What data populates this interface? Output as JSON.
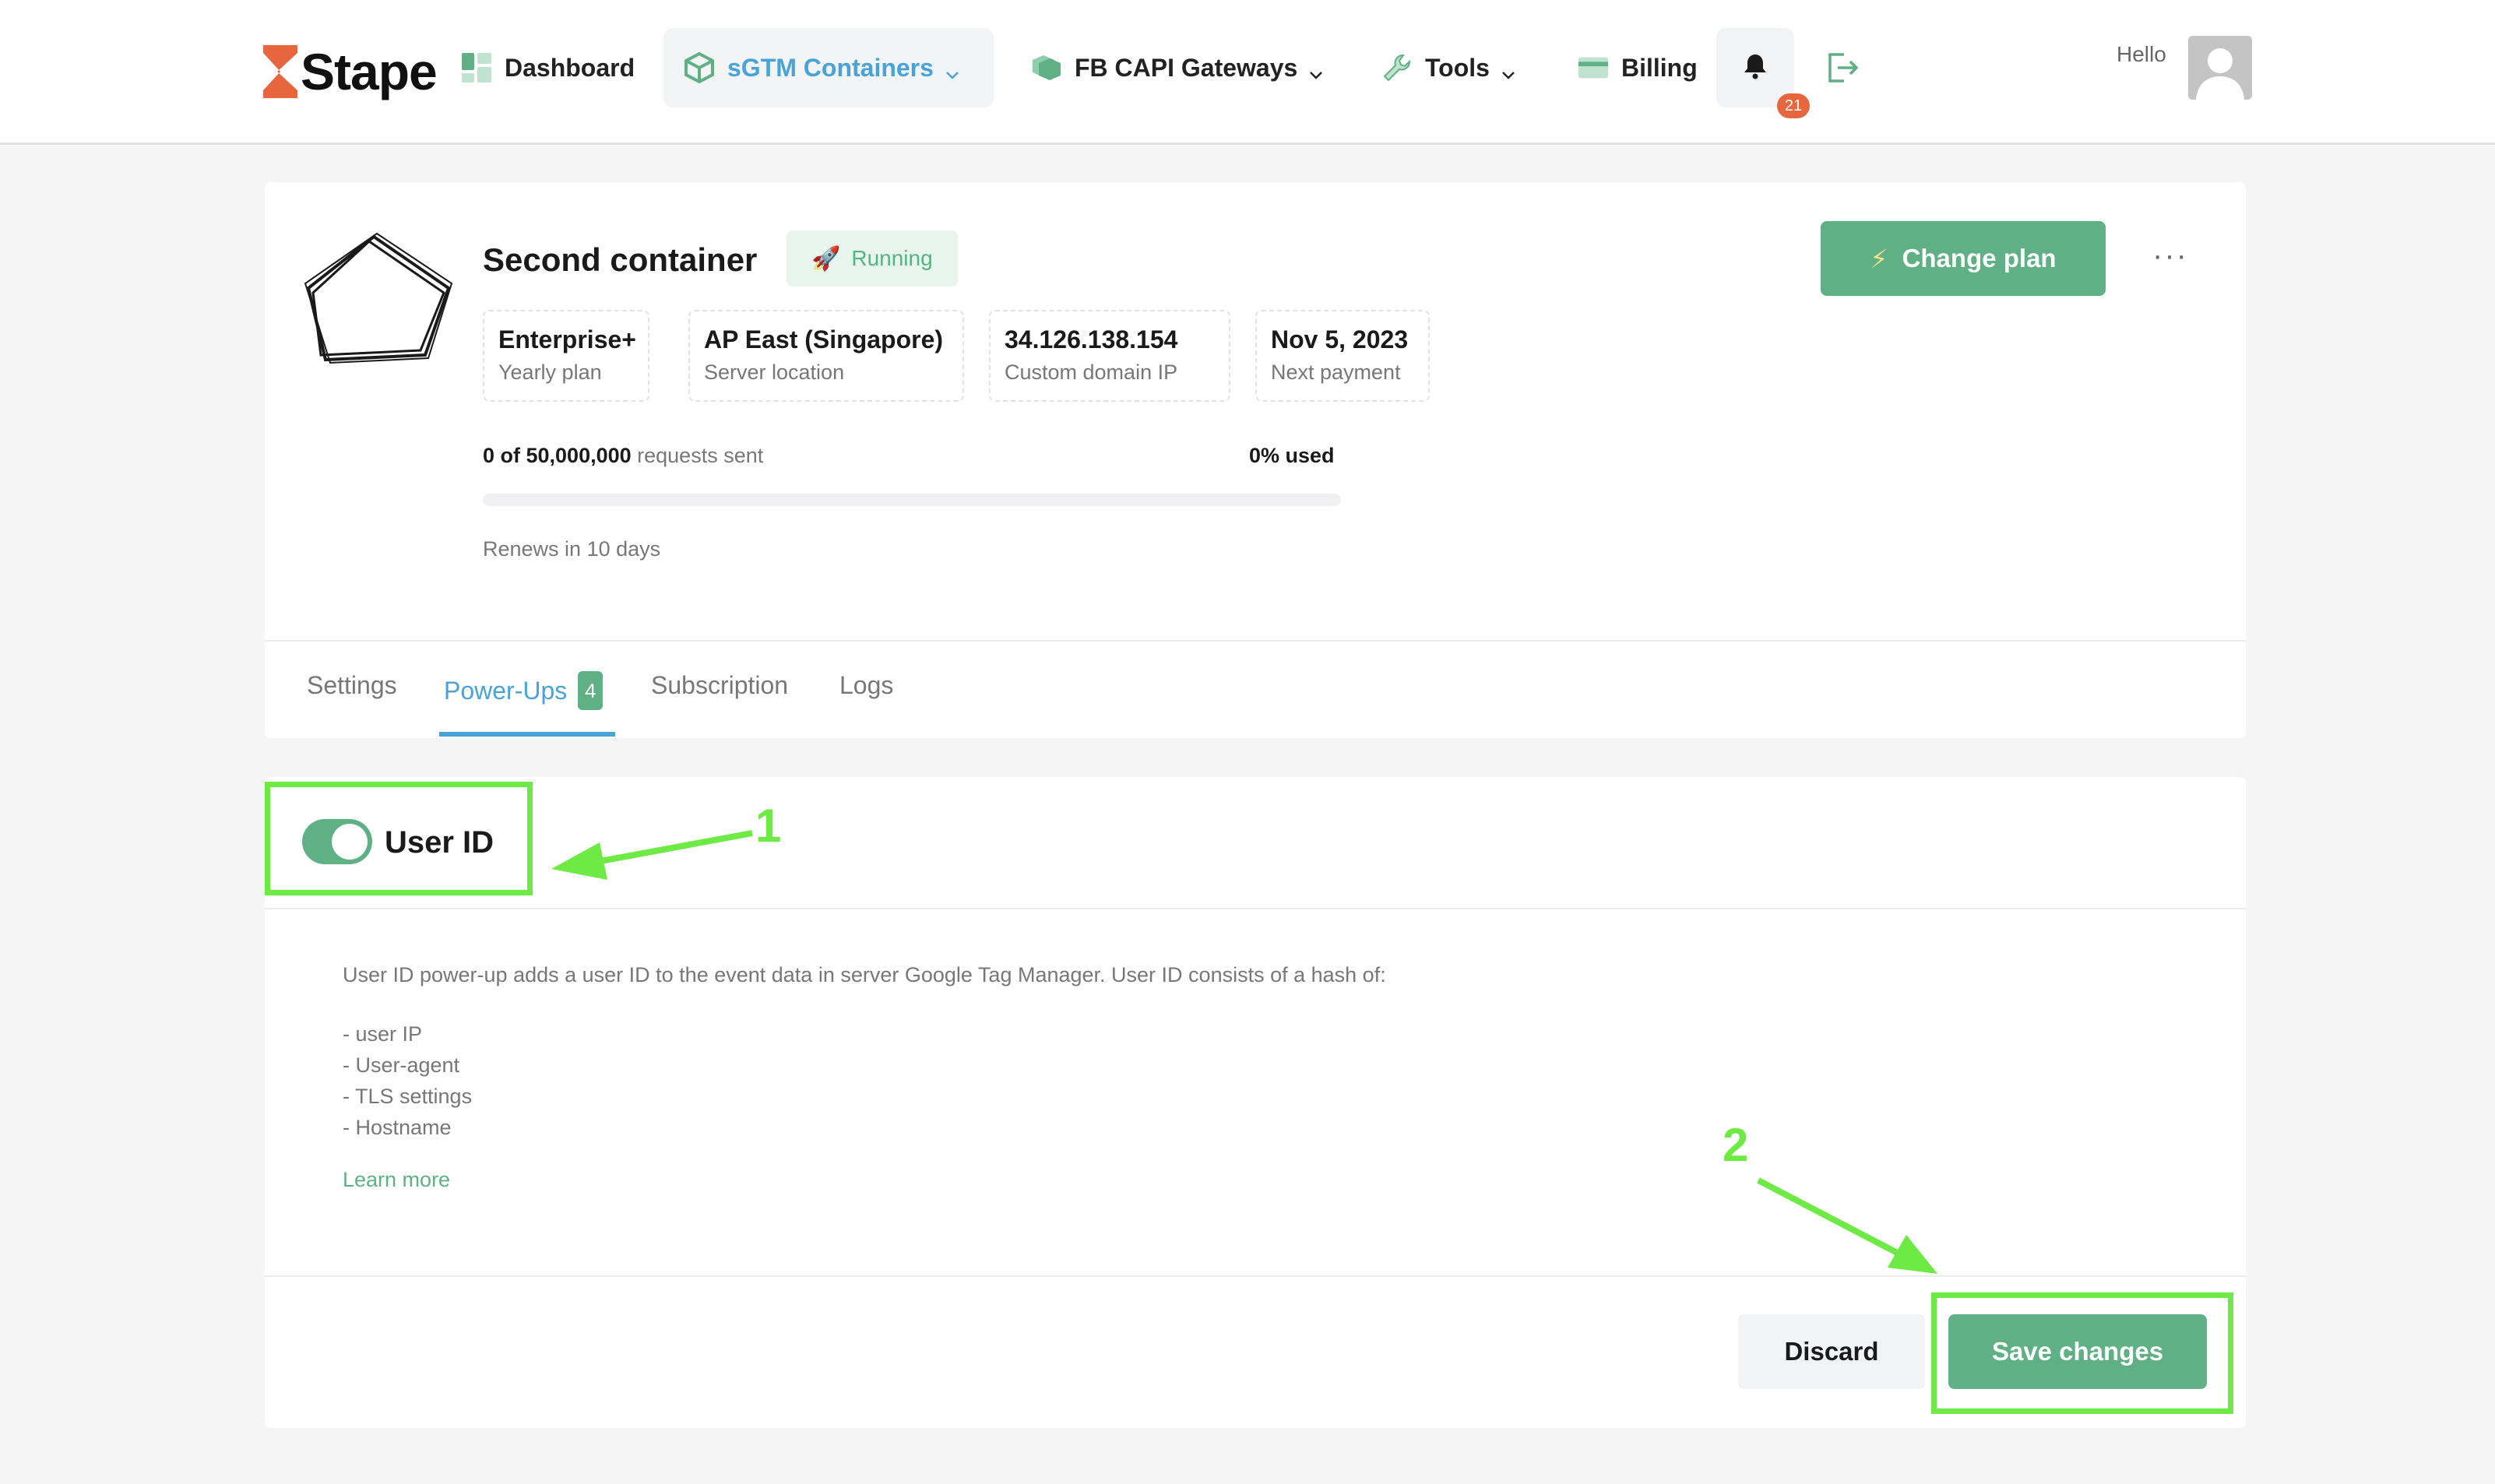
{
  "brand": {
    "name": "Stape",
    "accent": "#5fb084",
    "link_blue": "#4aa3d8",
    "logo_orange": "#e8663d"
  },
  "nav": {
    "dashboard": "Dashboard",
    "sgtm": "sGTM Containers",
    "fbcapi": "FB CAPI Gateways",
    "tools": "Tools",
    "billing": "Billing",
    "notifications_count": "21",
    "hello": "Hello"
  },
  "container": {
    "name": "Second container",
    "status": "Running",
    "change_plan": "Change plan",
    "more": "···",
    "info": [
      {
        "value": "Enterprise+",
        "label": "Yearly plan"
      },
      {
        "value": "AP East (Singapore)",
        "label": "Server location"
      },
      {
        "value": "34.126.138.154",
        "label": "Custom domain IP"
      },
      {
        "value": "Nov 5, 2023",
        "label": "Next payment"
      }
    ],
    "requests_count": "0 of 50,000,000",
    "requests_suffix": " requests sent",
    "used": "0% used",
    "usage_fraction": 0,
    "renews": "Renews in 10 days"
  },
  "tabs": {
    "settings": "Settings",
    "powerups": "Power-Ups",
    "powerups_count": "4",
    "subscription": "Subscription",
    "logs": "Logs"
  },
  "powerup": {
    "title": "User ID",
    "enabled": true,
    "description": "User ID power-up adds a user ID to the event data in server Google Tag Manager. User ID consists of a hash of:",
    "bullets": [
      "- user IP",
      "- User-agent",
      "- TLS settings",
      "- Hostname"
    ],
    "learn_more": "Learn more",
    "discard": "Discard",
    "save": "Save changes"
  },
  "annotations": {
    "step1": "1",
    "step2": "2",
    "color": "#6eea45"
  }
}
